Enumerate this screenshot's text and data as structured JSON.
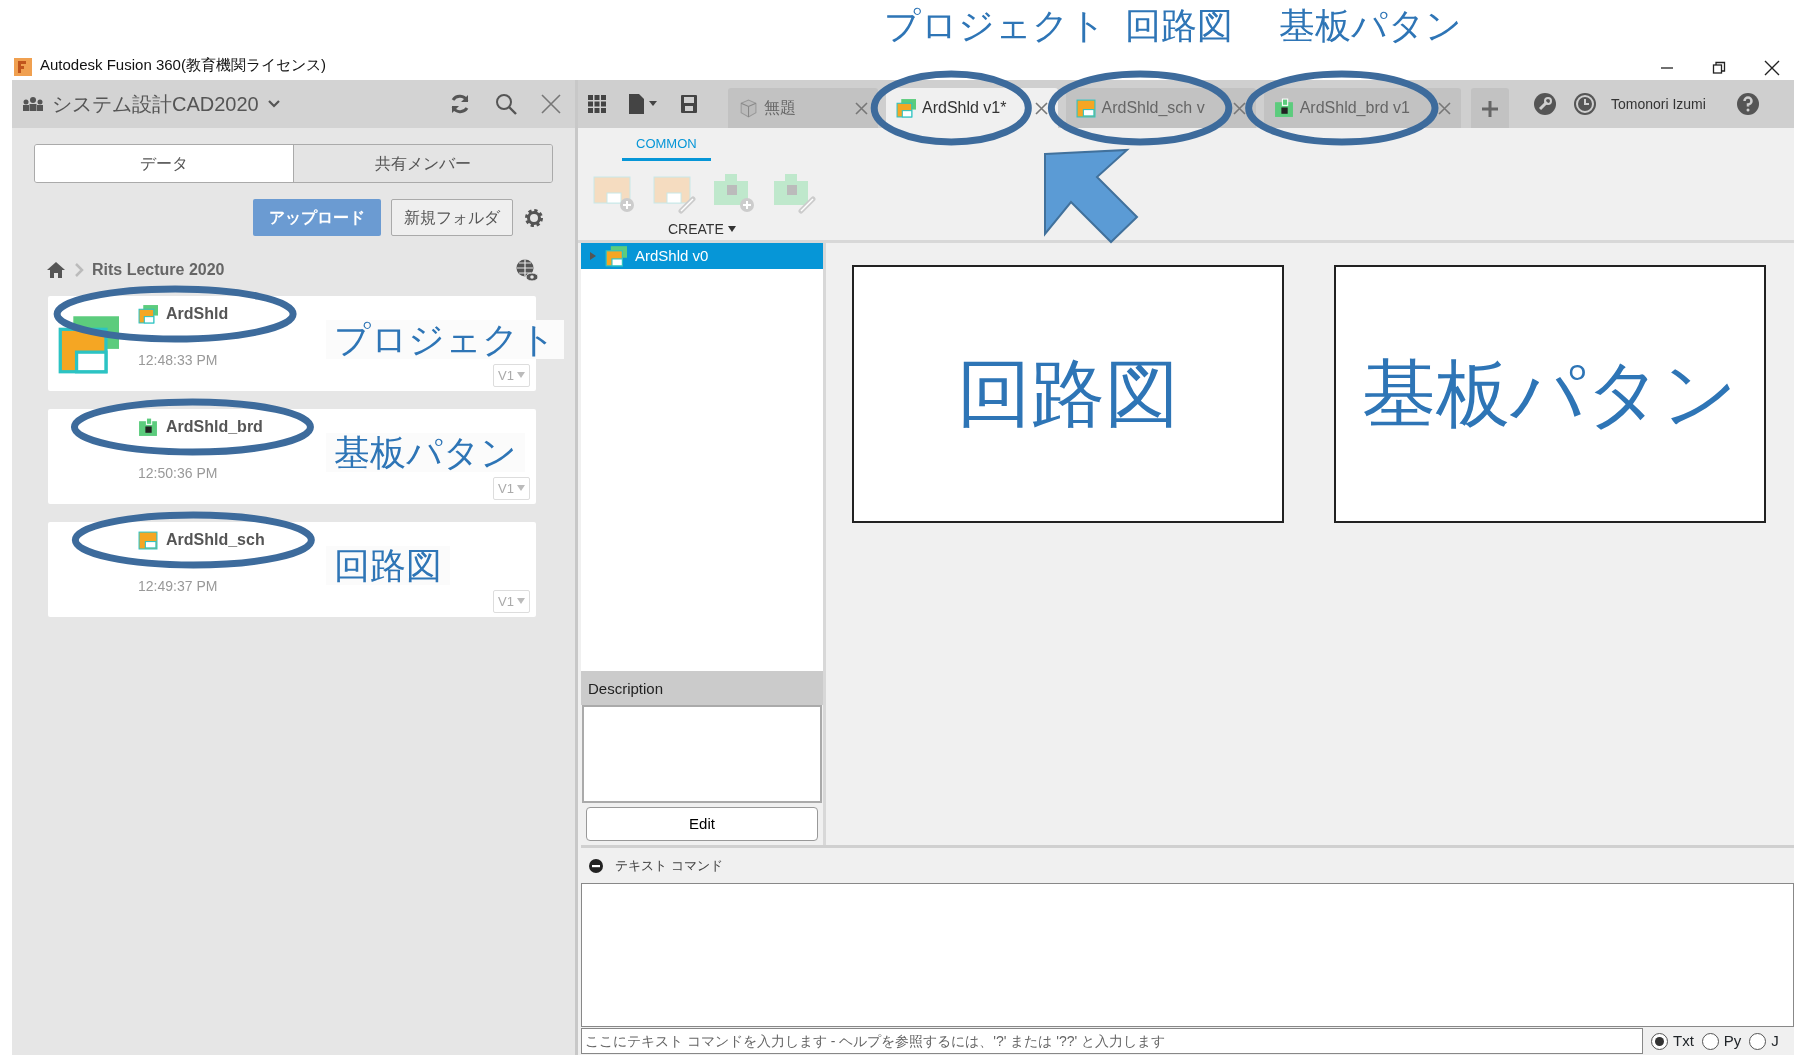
{
  "window": {
    "title": "Autodesk Fusion 360(教育機関ライセンス)"
  },
  "data_panel": {
    "project": "システム設計CAD2020",
    "tabs": [
      {
        "label": "データ",
        "selected": true
      },
      {
        "label": "共有メンバー",
        "selected": false
      }
    ],
    "upload_button": "アップロード",
    "new_folder_button": "新規フォルダ",
    "breadcrumb": "Rits Lecture 2020",
    "files": [
      {
        "name": "ArdShld",
        "kind": "project",
        "time": "12:48:33 PM",
        "version": "V1"
      },
      {
        "name": "ArdShld_brd",
        "kind": "board",
        "time": "12:50:36 PM",
        "version": "V1"
      },
      {
        "name": "ArdShld_sch",
        "kind": "schematic",
        "time": "12:49:37 PM",
        "version": "V1"
      }
    ]
  },
  "document_tabs": [
    {
      "label": "無題",
      "kind": "part",
      "selected": false
    },
    {
      "label": "ArdShld v1*",
      "kind": "project",
      "selected": true
    },
    {
      "label": "ArdShld_sch v",
      "kind": "schematic",
      "selected": false
    },
    {
      "label": "ArdShld_brd v1",
      "kind": "board",
      "selected": false
    }
  ],
  "user": "Tomonori Izumi",
  "ribbon": {
    "tabs": [
      {
        "label": "COMMON",
        "selected": true
      }
    ],
    "group": "CREATE"
  },
  "browser": {
    "items": [
      {
        "label": "ArdShld v0",
        "selected": true
      }
    ],
    "description_label": "Description",
    "edit_button": "Edit"
  },
  "text_command": {
    "title": "テキスト コマンド",
    "placeholder": "ここにテキスト コマンドを入力します - ヘルプを参照するには、'?' または '??' と入力します",
    "modes": [
      {
        "label": "Txt",
        "selected": true
      },
      {
        "label": "Py",
        "selected": false
      },
      {
        "label": "J",
        "selected": false
      }
    ]
  },
  "annotations": {
    "tab_labels": [
      "プロジェクト",
      "回路図",
      "基板パタン"
    ],
    "file_labels": [
      "プロジェクト",
      "基板パタン",
      "回路図"
    ],
    "canvas_boxes": [
      "回路図",
      "基板パタン"
    ]
  }
}
